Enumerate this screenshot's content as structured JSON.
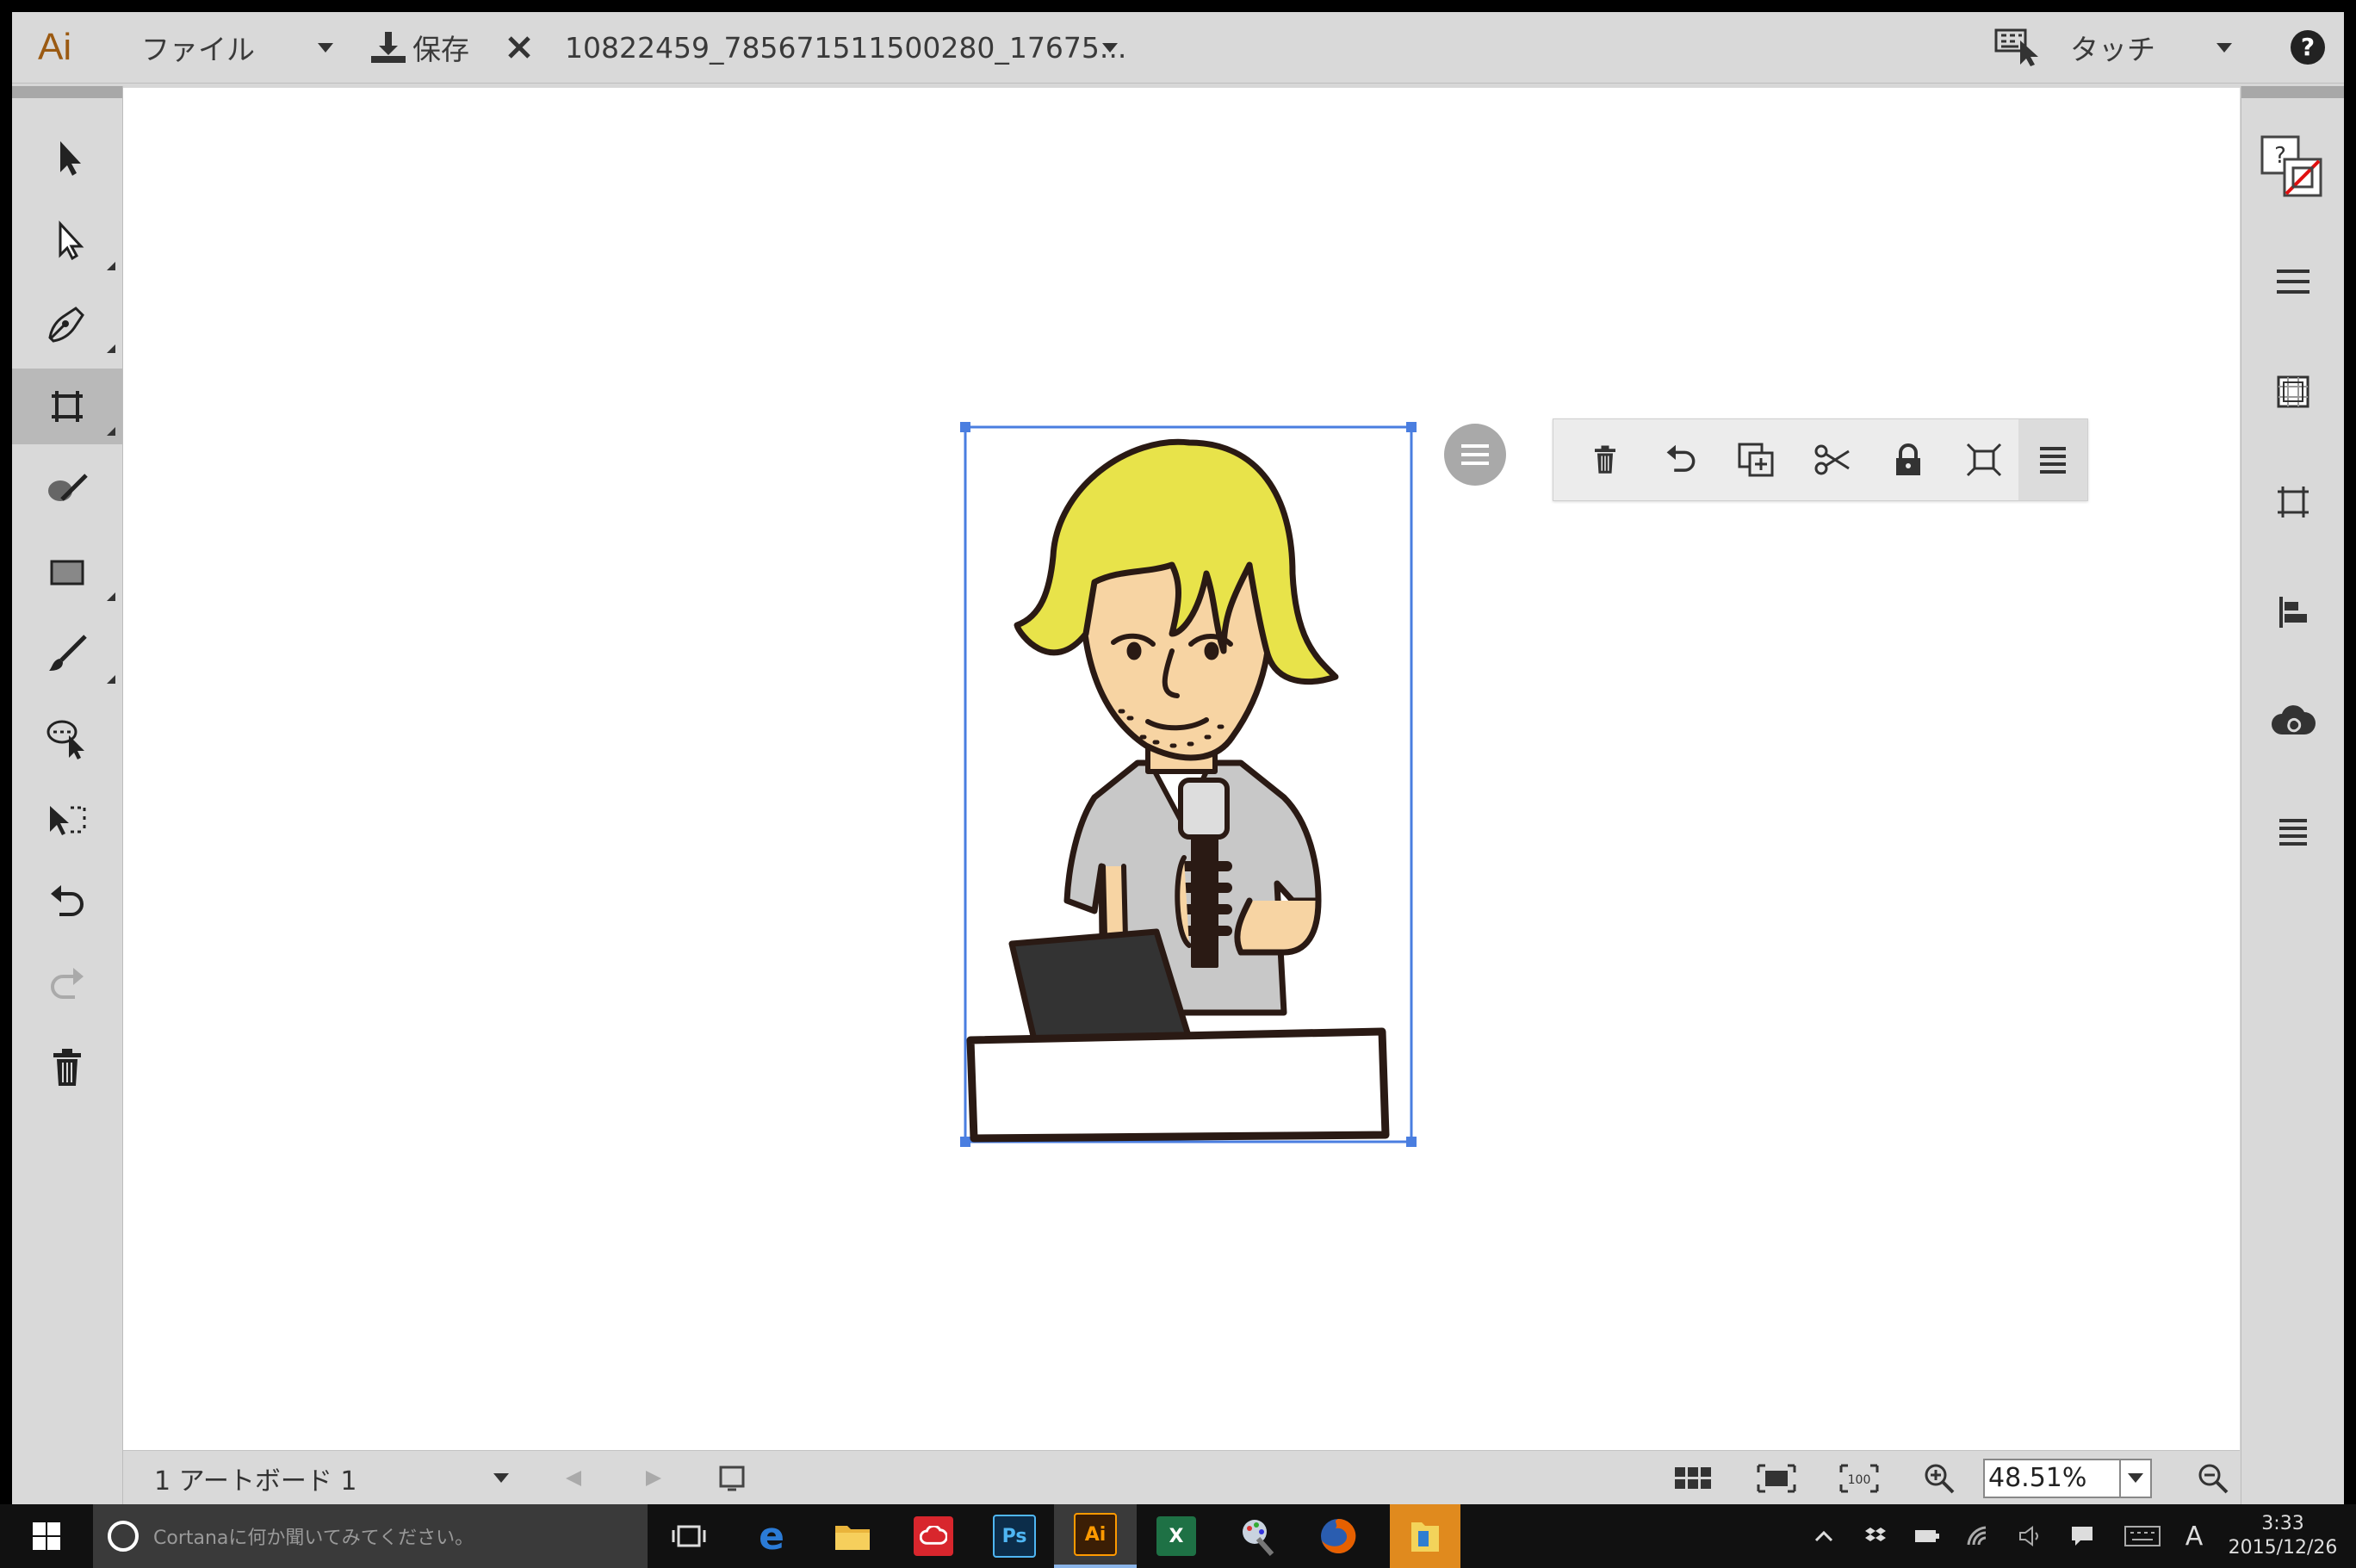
{
  "app": {
    "logo": "Ai",
    "brand_color": "#9b5a12"
  },
  "topbar": {
    "file_menu": "ファイル",
    "save_label": "保存",
    "document_name": "10822459_785671511500280_17675...",
    "mode_label": "タッチ"
  },
  "left_tools": [
    {
      "name": "selection-tool",
      "icon": "arrow-filled-icon"
    },
    {
      "name": "direct-selection-tool",
      "icon": "arrow-hollow-icon"
    },
    {
      "name": "pen-tool",
      "icon": "pen-icon"
    },
    {
      "name": "artboard-tool",
      "icon": "artboard-icon",
      "active": true
    },
    {
      "name": "shaper-tool",
      "icon": "shaper-icon"
    },
    {
      "name": "rectangle-tool",
      "icon": "rectangle-icon"
    },
    {
      "name": "brush-tool",
      "icon": "brush-icon"
    },
    {
      "name": "zoom-select-tool",
      "icon": "lasso-icon"
    },
    {
      "name": "transform-tool",
      "icon": "free-transform-icon"
    },
    {
      "name": "undo-tool",
      "icon": "undo-icon"
    },
    {
      "name": "redo-tool",
      "icon": "redo-icon"
    },
    {
      "name": "delete-tool",
      "icon": "trash-icon"
    }
  ],
  "right_tools": [
    {
      "name": "fill-stroke-swatch",
      "icon": "fill-stroke-icon"
    },
    {
      "name": "stroke-panel",
      "icon": "stroke-lines-icon"
    },
    {
      "name": "transparency-panel",
      "icon": "transparency-icon"
    },
    {
      "name": "artboard-panel",
      "icon": "artboard-icon"
    },
    {
      "name": "align-panel",
      "icon": "align-icon"
    },
    {
      "name": "libraries-panel",
      "icon": "creative-cloud-icon"
    },
    {
      "name": "layers-panel",
      "icon": "layers-icon"
    }
  ],
  "context_toolbar": {
    "items": [
      "trash-icon",
      "undo-icon",
      "duplicate-icon",
      "cut-icon",
      "lock-icon",
      "fit-icon",
      "menu-icon"
    ]
  },
  "statusbar": {
    "artboard_label": "1 アートボード 1",
    "zoom_value": "48.51%"
  },
  "taskbar": {
    "search_placeholder": "Cortanaに何か聞いてみてください。",
    "ime_label": "A",
    "time": "3:33",
    "date": "2015/12/26",
    "apps": [
      {
        "name": "task-view",
        "label": ""
      },
      {
        "name": "edge",
        "label": "e",
        "color": "#2b7bd6"
      },
      {
        "name": "file-explorer",
        "label": "",
        "color": "#e9b43b"
      },
      {
        "name": "creative-cloud",
        "label": "",
        "color": "#d8262d"
      },
      {
        "name": "photoshop",
        "label": "Ps",
        "color": "#0c2d4a"
      },
      {
        "name": "illustrator",
        "label": "Ai",
        "color": "#3b1e05"
      },
      {
        "name": "excel",
        "label": "X",
        "color": "#1e7145"
      },
      {
        "name": "paint",
        "label": "",
        "color": "#6b7a8c"
      },
      {
        "name": "firefox",
        "label": "",
        "color": "#e66000"
      },
      {
        "name": "explorer-active",
        "label": "",
        "color": "#f3a63b"
      }
    ]
  }
}
